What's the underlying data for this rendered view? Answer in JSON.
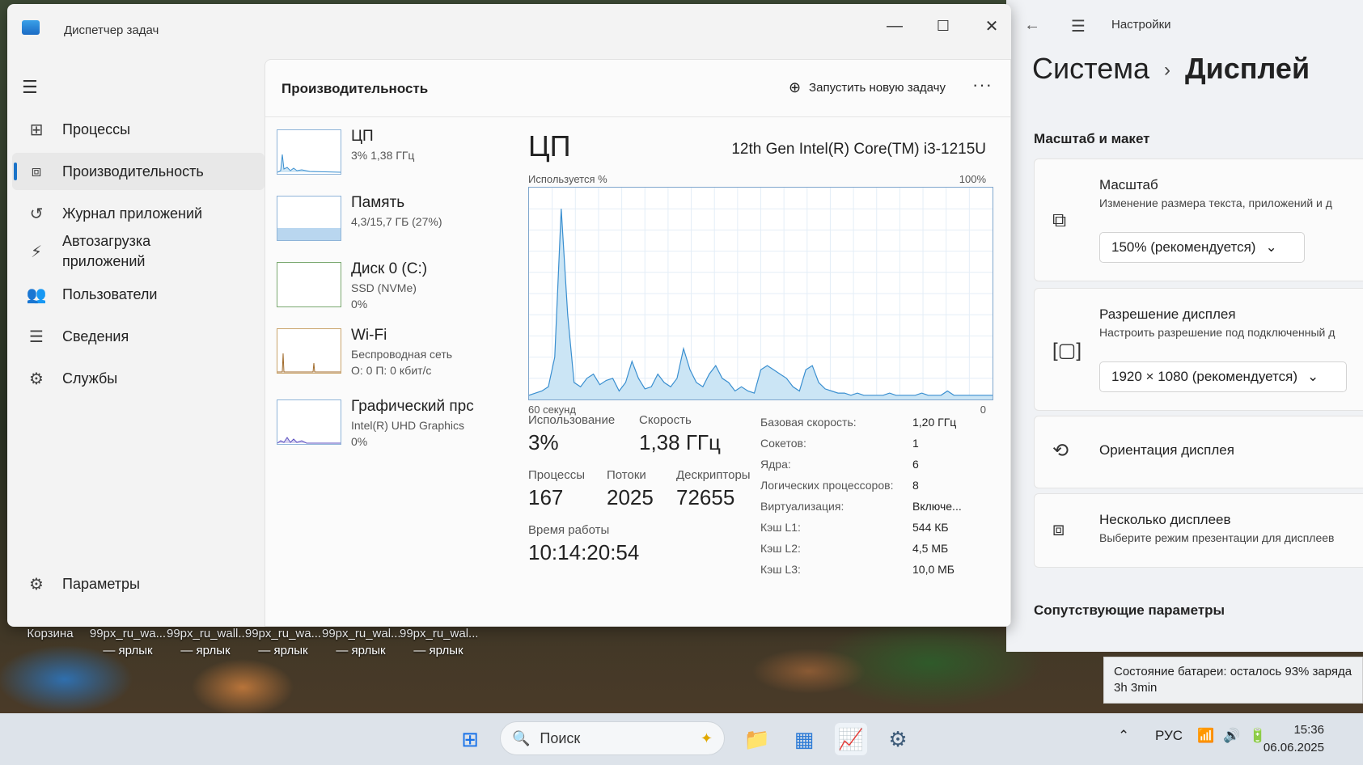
{
  "desktop": {
    "icons": [
      {
        "name": "Корзина",
        "sub": ""
      },
      {
        "name": "99px_ru_wa...",
        "sub": "— ярлык"
      },
      {
        "name": "99px_ru_wall...",
        "sub": "— ярлык"
      },
      {
        "name": "99px_ru_wa...",
        "sub": "— ярлык"
      },
      {
        "name": "99px_ru_wal...",
        "sub": "— ярлык"
      },
      {
        "name": "99px_ru_wal...",
        "sub": "— ярлык"
      }
    ]
  },
  "taskmanager": {
    "title": "Диспетчер задач",
    "nav": [
      {
        "label": "Процессы",
        "icon": "processes-icon"
      },
      {
        "label": "Производительность",
        "icon": "performance-icon",
        "active": true
      },
      {
        "label": "Журнал приложений",
        "icon": "history-icon"
      },
      {
        "label": "Автозагрузка\nприложений",
        "icon": "startup-icon"
      },
      {
        "label": "Пользователи",
        "icon": "users-icon"
      },
      {
        "label": "Сведения",
        "icon": "details-icon"
      },
      {
        "label": "Службы",
        "icon": "services-icon"
      }
    ],
    "settings_label": "Параметры",
    "header": {
      "title": "Производительность",
      "run_task": "Запустить новую задачу"
    },
    "devices": [
      {
        "name": "ЦП",
        "line1": "3%  1,38 ГГц",
        "line2": ""
      },
      {
        "name": "Память",
        "line1": "4,3/15,7 ГБ (27%)",
        "line2": ""
      },
      {
        "name": "Диск 0 (C:)",
        "line1": "SSD (NVMe)",
        "line2": "0%"
      },
      {
        "name": "Wi-Fi",
        "line1": "Беспроводная сеть",
        "line2": "О: 0  П: 0 кбит/с"
      },
      {
        "name": "Графический прс",
        "line1": "Intel(R) UHD Graphics",
        "line2": "0%"
      }
    ],
    "cpu": {
      "title": "ЦП",
      "model": "12th Gen Intel(R) Core(TM) i3-1215U",
      "graph_label": "Используется %",
      "graph_max": "100%",
      "graph_time": "60 секунд",
      "graph_zero": "0",
      "usage_history": [
        2,
        3,
        4,
        6,
        20,
        90,
        40,
        8,
        6,
        10,
        12,
        7,
        9,
        10,
        4,
        8,
        18,
        10,
        5,
        6,
        12,
        8,
        6,
        10,
        24,
        14,
        8,
        6,
        12,
        16,
        10,
        8,
        4,
        6,
        4,
        3,
        14,
        16,
        14,
        12,
        10,
        6,
        4,
        14,
        16,
        8,
        5,
        4,
        3,
        3,
        2,
        3,
        2,
        2,
        2,
        2,
        3,
        2,
        2,
        2,
        2,
        3,
        2,
        2,
        2,
        4,
        2,
        2,
        2,
        2,
        2,
        2,
        2
      ],
      "stats": {
        "usage_label": "Использование",
        "usage": "3%",
        "speed_label": "Скорость",
        "speed": "1,38 ГГц",
        "proc_label": "Процессы",
        "proc": "167",
        "threads_label": "Потоки",
        "threads": "2025",
        "handles_label": "Дескрипторы",
        "handles": "72655",
        "uptime_label": "Время работы",
        "uptime": "10:14:20:54"
      },
      "specs": [
        {
          "k": "Базовая скорость:",
          "v": "1,20 ГГц"
        },
        {
          "k": "Сокетов:",
          "v": "1"
        },
        {
          "k": "Ядра:",
          "v": "6"
        },
        {
          "k": "Логических процессоров:",
          "v": "8"
        },
        {
          "k": "Виртуализация:",
          "v": "Включе..."
        },
        {
          "k": "Кэш L1:",
          "v": "544 КБ"
        },
        {
          "k": "Кэш L2:",
          "v": "4,5 МБ"
        },
        {
          "k": "Кэш L3:",
          "v": "10,0 МБ"
        }
      ]
    }
  },
  "settings": {
    "title": "Настройки",
    "breadcrumb_parent": "Система",
    "breadcrumb_current": "Дисплей",
    "section": "Масштаб и макет",
    "scale": {
      "title": "Масштаб",
      "desc": "Изменение размера текста, приложений и д",
      "value": "150% (рекомендуется)"
    },
    "resolution": {
      "title": "Разрешение дисплея",
      "desc": "Настроить разрешение под подключенный д",
      "value": "1920 × 1080 (рекомендуется)"
    },
    "orientation": {
      "title": "Ориентация дисплея"
    },
    "multi": {
      "title": "Несколько дисплеев",
      "desc": "Выберите режим презентации для дисплеев"
    },
    "related": "Сопутствующие параметры"
  },
  "toast": {
    "line1": "Состояние батареи: осталось 93% заряда",
    "line2": "3h 3min"
  },
  "taskbar": {
    "search": "Поиск",
    "lang": "РУС",
    "time": "15:36",
    "date": "06.06.2025"
  }
}
